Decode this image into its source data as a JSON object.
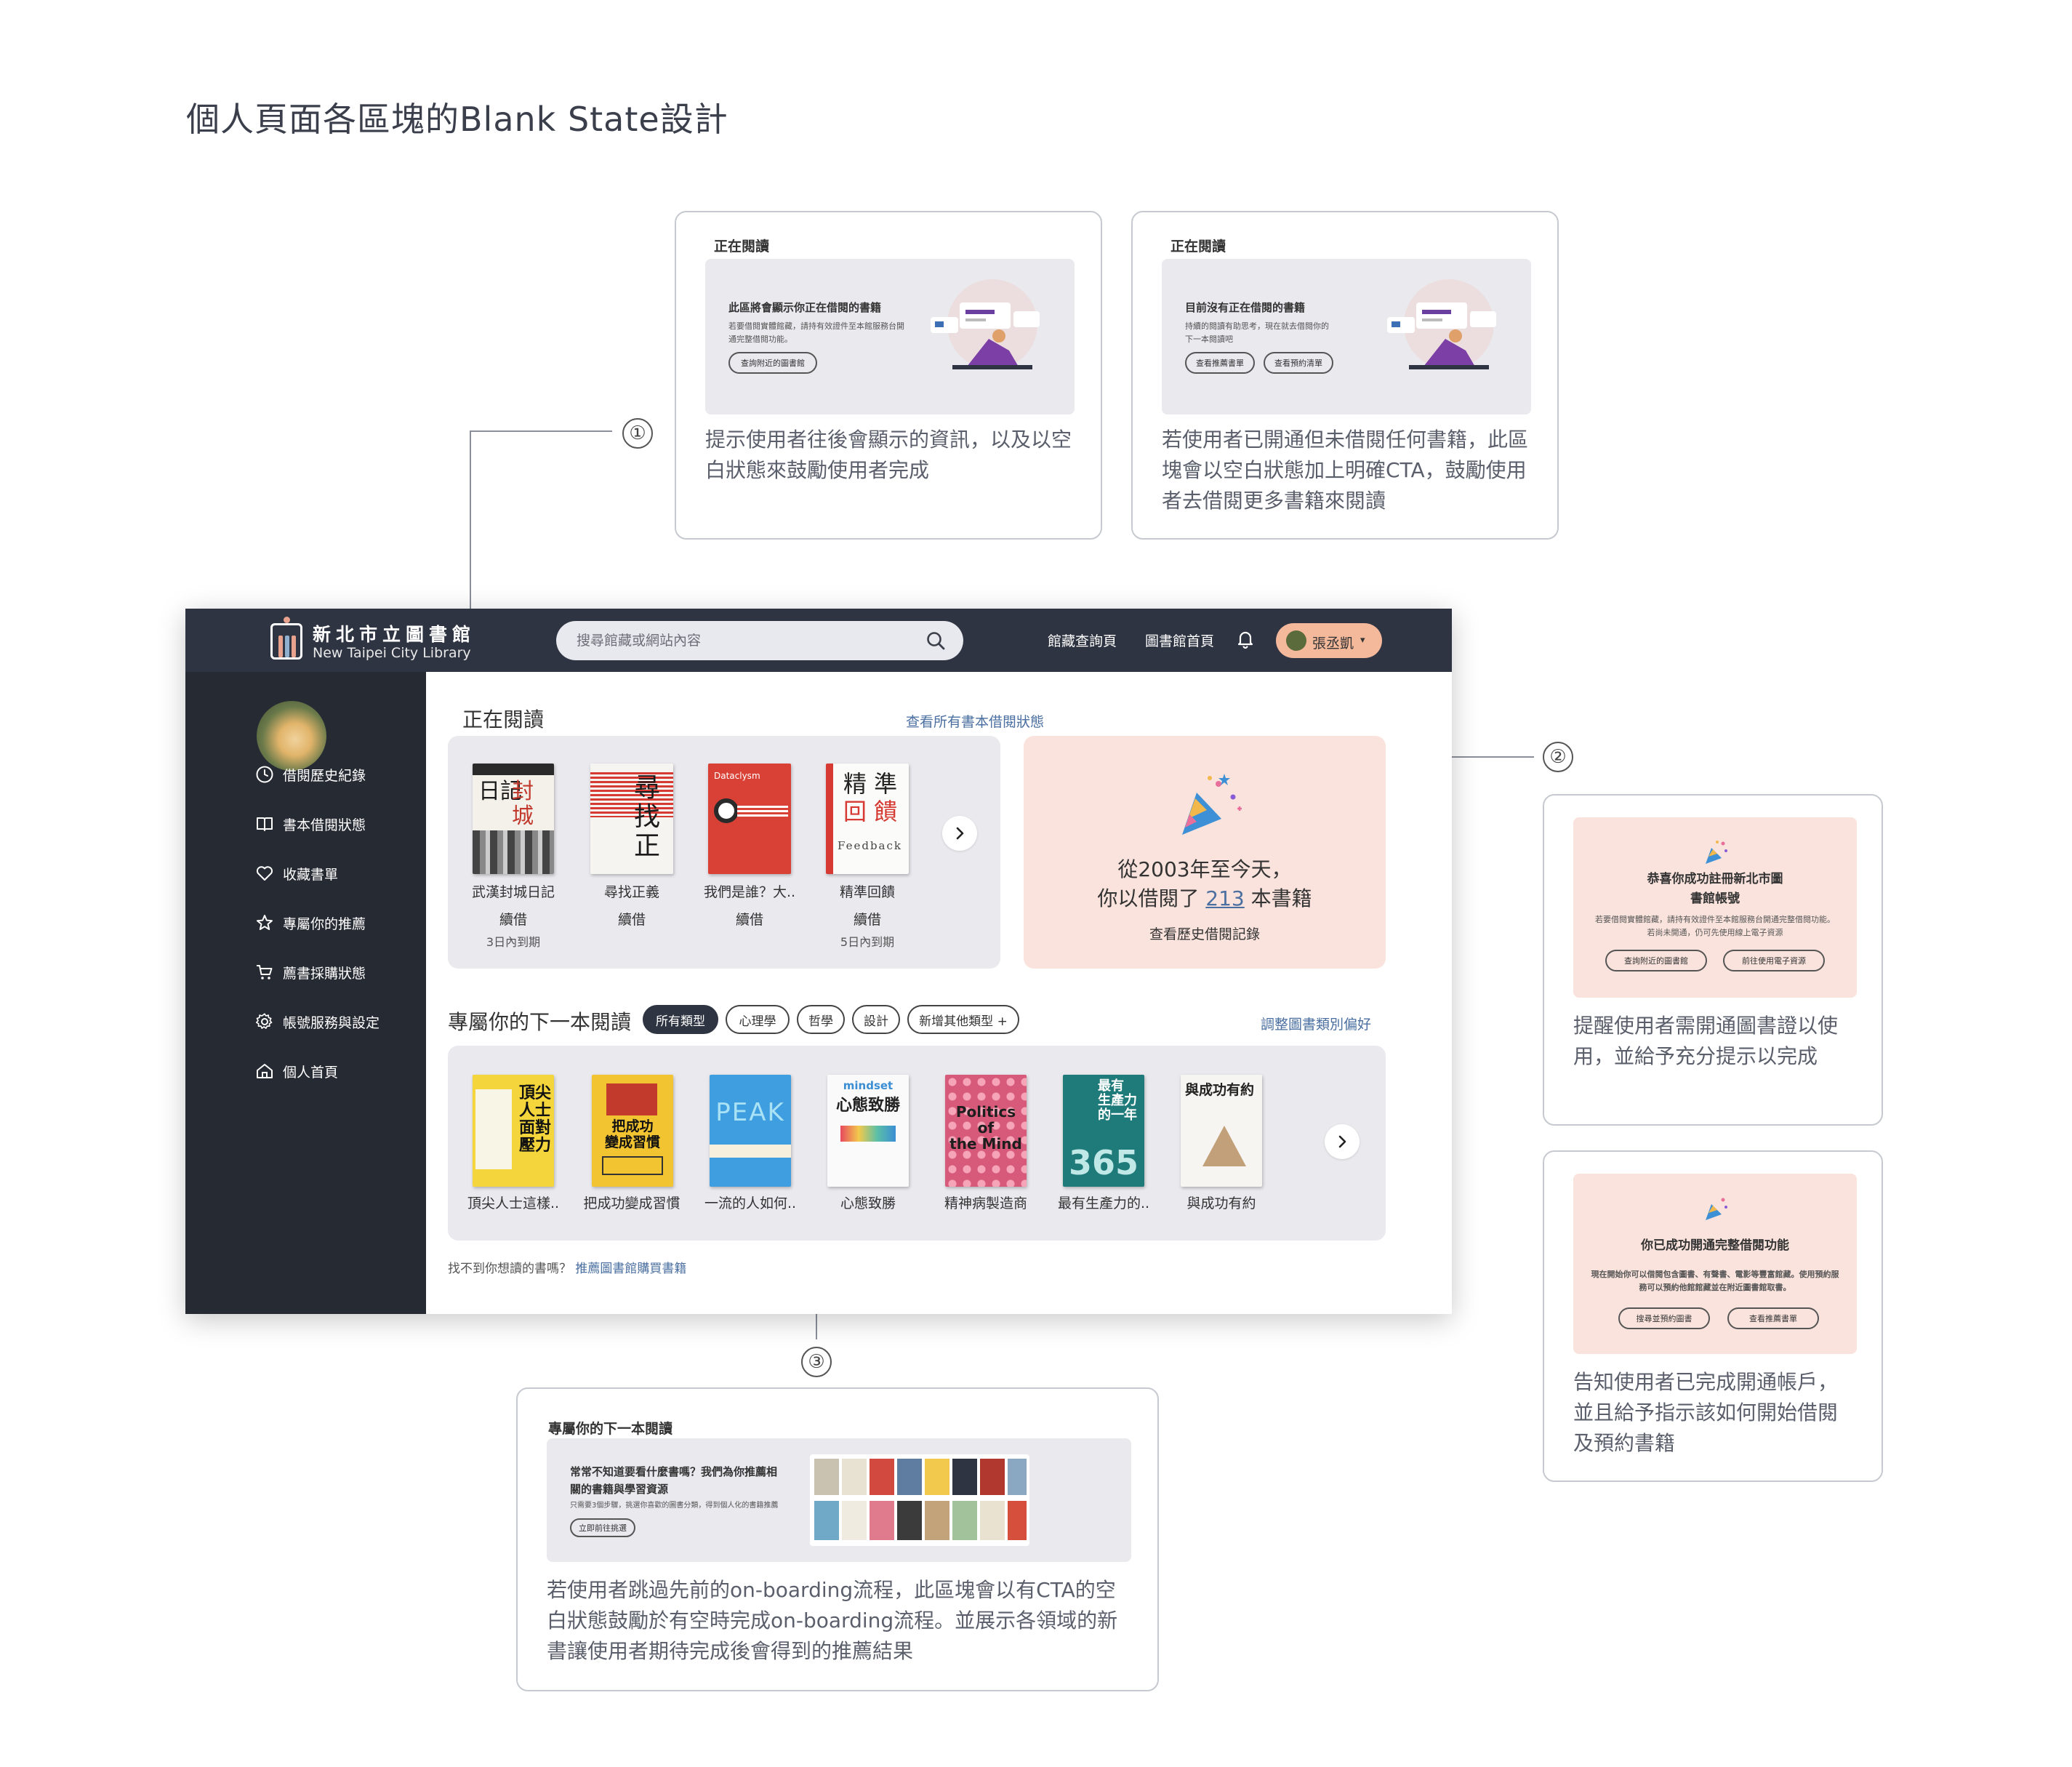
{
  "page_title": "個人頁面各區塊的Blank State設計",
  "callouts": [
    "①",
    "②",
    "③"
  ],
  "annotations": {
    "card1": {
      "label": "正在閱讀",
      "preview_title": "此區將會顯示你正在借閱的書籍",
      "preview_body": "若要借閱實體館藏，請持有效證件至本館服務台開通完整借閱功能。",
      "button": "查詢附近的圖書館",
      "desc": "提示使用者往後會顯示的資訊，以及以空白狀態來鼓勵使用者完成"
    },
    "card2": {
      "label": "正在閱讀",
      "preview_title": "目前沒有正在借閱的書籍",
      "preview_body": "持續的閱讀有助思考，現在就去借閱你的下一本閱讀吧",
      "buttons": [
        "查看推薦書單",
        "查看預約清單"
      ],
      "desc": "若使用者已開通但未借閱任何書籍，此區塊會以空白狀態加上明確CTA，鼓勵使用者去借閱更多書籍來閱讀"
    },
    "card3": {
      "label": "專屬你的下一本閱讀",
      "preview_title": "常常不知道要看什麼書嗎？我們為你推薦相關的書籍與學習資源",
      "preview_body": "只需要3個步驟，挑選你喜歡的圖書分類，得到個人化的書籍推薦",
      "button": "立即前往挑選",
      "desc": "若使用者跳過先前的on-boarding流程，此區塊會以有CTA的空白狀態鼓勵於有空時完成on-boarding流程。並展示各領域的新書讓使用者期待完成後會得到的推薦結果"
    },
    "card4": {
      "preview_title": "恭喜你成功註冊新北市圖書館帳號",
      "preview_body": "若要借閱實體館藏，請持有效證件至本館服務台開通完整借閱功能。若尚未開通，仍可先使用線上電子資源",
      "buttons": [
        "查詢附近的圖書館",
        "前往使用電子資源"
      ],
      "desc": "提醒使用者需開通圖書證以使用，並給予充分提示以完成"
    },
    "card5": {
      "preview_title": "你已成功開通完整借閱功能",
      "preview_body": "現在開始你可以借閱包含圖書、有聲書、電影等豐富館藏。使用預約服務可以預約他館館藏並在附近圖書館取書。",
      "buttons": [
        "搜尋並預約圖書",
        "查看推薦書單"
      ],
      "desc": "告知使用者已完成開通帳戶，並且給予指示該如何開始借閱及預約書籍"
    }
  },
  "app": {
    "logo_zh": "新北市立圖書館",
    "logo_en": "New Taipei City Library",
    "search_placeholder": "搜尋館藏或網站內容",
    "nav": [
      "館藏查詢頁",
      "圖書館首頁"
    ],
    "user_name": "張丞凱",
    "sidebar": [
      {
        "label": "借閱歷史紀錄",
        "icon": "clock-icon"
      },
      {
        "label": "書本借閱狀態",
        "icon": "book-icon"
      },
      {
        "label": "收藏書單",
        "icon": "heart-icon"
      },
      {
        "label": "專屬你的推薦",
        "icon": "star-icon"
      },
      {
        "label": "薦書採購狀態",
        "icon": "cart-icon"
      },
      {
        "label": "帳號服務與設定",
        "icon": "gear-icon"
      },
      {
        "label": "個人首頁",
        "icon": "home-icon"
      }
    ],
    "reading": {
      "title": "正在閱讀",
      "link": "查看所有書本借閱狀態",
      "books": [
        {
          "title": "武漢封城日記",
          "action": "續借",
          "due": "3日內到期"
        },
        {
          "title": "尋找正義",
          "action": "續借",
          "due": ""
        },
        {
          "title": "我們是誰？大..",
          "action": "續借",
          "due": ""
        },
        {
          "title": "精準回饋",
          "action": "續借",
          "due": "5日內到期"
        }
      ]
    },
    "stats": {
      "line1": "從2003年至今天，",
      "line2_prefix": "你以借閱了",
      "count": "213",
      "line2_suffix": "本書籍",
      "link": "查看歷史借閱記錄"
    },
    "recommend": {
      "title": "專屬你的下一本閱讀",
      "chips": [
        "所有類型",
        "心理學",
        "哲學",
        "設計",
        "新增其他類型 +"
      ],
      "link": "調整圖書類別偏好",
      "books": [
        "頂尖人士這樣..",
        "把成功變成習慣",
        "一流的人如何..",
        "心態致勝",
        "精神病製造商",
        "最有生產力的..",
        "與成功有約"
      ]
    },
    "footer_text": "找不到你想讀的書嗎？",
    "footer_link": "推薦圖書館購買書籍"
  }
}
